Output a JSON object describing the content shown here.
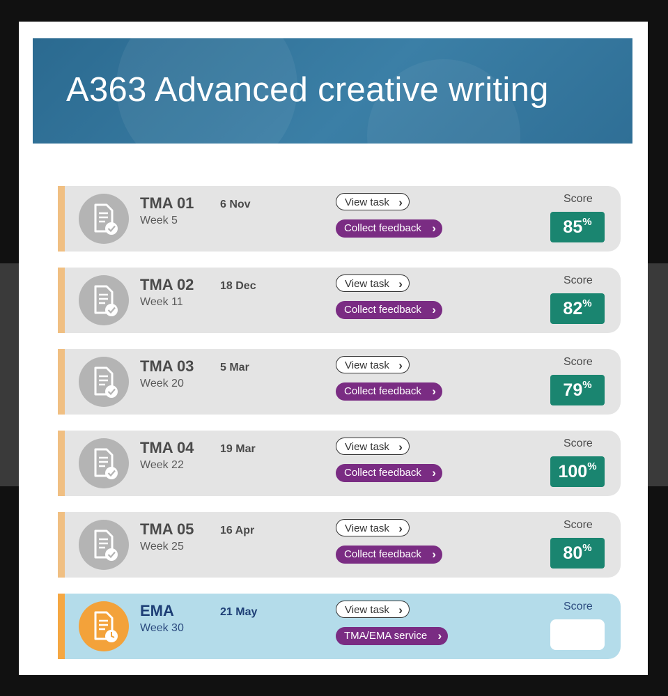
{
  "module": {
    "title": "A363 Advanced creative writing"
  },
  "assignments": [
    {
      "name": "TMA 01",
      "week": "Week 5",
      "date": "6 Nov",
      "view_label": "View task",
      "action_label": "Collect feedback",
      "score_label": "Score",
      "score": "85",
      "percent": "%",
      "type": "completed",
      "icon": "document-check-icon"
    },
    {
      "name": "TMA 02",
      "week": "Week 11",
      "date": "18 Dec",
      "view_label": "View task",
      "action_label": "Collect feedback",
      "score_label": "Score",
      "score": "82",
      "percent": "%",
      "type": "completed",
      "icon": "document-check-icon"
    },
    {
      "name": "TMA 03",
      "week": "Week 20",
      "date": "5 Mar",
      "view_label": "View task",
      "action_label": "Collect feedback",
      "score_label": "Score",
      "score": "79",
      "percent": "%",
      "type": "completed",
      "icon": "document-check-icon"
    },
    {
      "name": "TMA 04",
      "week": "Week 22",
      "date": "19 Mar",
      "view_label": "View task",
      "action_label": "Collect feedback",
      "score_label": "Score",
      "score": "100",
      "percent": "%",
      "type": "completed",
      "icon": "document-check-icon"
    },
    {
      "name": "TMA 05",
      "week": "Week 25",
      "date": "16 Apr",
      "view_label": "View task",
      "action_label": "Collect feedback",
      "score_label": "Score",
      "score": "80",
      "percent": "%",
      "type": "completed",
      "icon": "document-check-icon"
    },
    {
      "name": "EMA",
      "week": "Week 30",
      "date": "21 May",
      "view_label": "View task",
      "action_label": "TMA/EMA service",
      "score_label": "Score",
      "score": "",
      "percent": "",
      "type": "pending",
      "icon": "document-clock-icon"
    }
  ],
  "colors": {
    "banner": "#2f6f96",
    "score_green": "#1a8570",
    "action_purple": "#7a2c83",
    "ema_row": "#b4dcea",
    "ema_icon": "#f3a23a"
  }
}
